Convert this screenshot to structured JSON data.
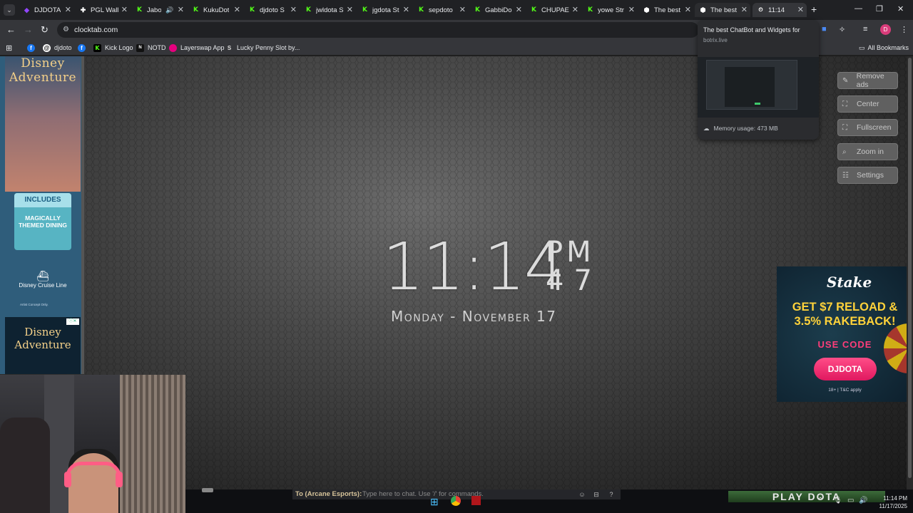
{
  "tabs": [
    {
      "title": "DJDOTA",
      "favicon": "twitch-icon"
    },
    {
      "title": "PGL Wall",
      "favicon": "pgl-icon"
    },
    {
      "title": "Jabol",
      "favicon": "kick-icon"
    },
    {
      "title": "KukuDot",
      "favicon": "kick-icon"
    },
    {
      "title": "djdoto S",
      "favicon": "kick-icon"
    },
    {
      "title": "jwldota S",
      "favicon": "kick-icon"
    },
    {
      "title": "jgdota St",
      "favicon": "kick-icon"
    },
    {
      "title": "sepdoto",
      "favicon": "kick-icon"
    },
    {
      "title": "GabbiDo",
      "favicon": "kick-icon"
    },
    {
      "title": "CHUPAE",
      "favicon": "kick-icon"
    },
    {
      "title": "yowe Str",
      "favicon": "kick-icon"
    },
    {
      "title": "The best",
      "favicon": "botrix-icon"
    },
    {
      "title": "The best",
      "favicon": "botrix-icon"
    },
    {
      "title": "11:14",
      "favicon": "clock-icon"
    }
  ],
  "address": {
    "url": "clocktab.com"
  },
  "bookmarks": [
    {
      "label": "",
      "icon": "facebook-icon"
    },
    {
      "label": "djdoto",
      "icon": "threads-icon"
    },
    {
      "label": "",
      "icon": "facebook-icon"
    },
    {
      "label": "Kick Logo",
      "icon": "kick-icon"
    },
    {
      "label": "NOTD",
      "icon": "notd-icon"
    },
    {
      "label": "Layerswap App",
      "icon": "layerswap-icon"
    },
    {
      "label": "Lucky Penny Slot by...",
      "icon": "s-icon"
    }
  ],
  "all_bookmarks": "All Bookmarks",
  "hover_card": {
    "title": "The best ChatBot and Widgets for",
    "domain": "botrix.live",
    "memory": "Memory usage: 473 MB"
  },
  "clock": {
    "time": "11:14",
    "ampm": "PM",
    "seconds": "47",
    "date": "Monday - November 17"
  },
  "controls": {
    "remove_ads": "Remove ads",
    "center": "Center",
    "fullscreen": "Fullscreen",
    "zoom_in": "Zoom in",
    "settings": "Settings"
  },
  "left_ad": {
    "brand": "Disney Adventure",
    "includes": "INCLUDES",
    "feature": "MAGICALLY THEMED DINING",
    "cruise_line": "Disney Cruise Line",
    "fine_print": "Artist Concept Only."
  },
  "stake_ad": {
    "logo": "Stake",
    "headline_1": "GET $7 RELOAD &",
    "headline_2": "3.5% RAKEBACK!",
    "use_code": "USE CODE",
    "code": "DJDOTA",
    "terms": "18+ | T&C apply"
  },
  "chatbar": {
    "target": "To (Arcane Esports):",
    "placeholder": "Type here to chat. Use '/' for commands.",
    "play_button": "PLAY DOTA"
  },
  "taskbar": {
    "time": "11:14 PM",
    "date": "11/17/2025"
  },
  "colors": {
    "browser_dark": "#202124",
    "toolbar": "#35363a",
    "stake_pink": "#ff3d7a",
    "stake_yellow": "#ffd23a",
    "kick_green": "#53fc18"
  }
}
